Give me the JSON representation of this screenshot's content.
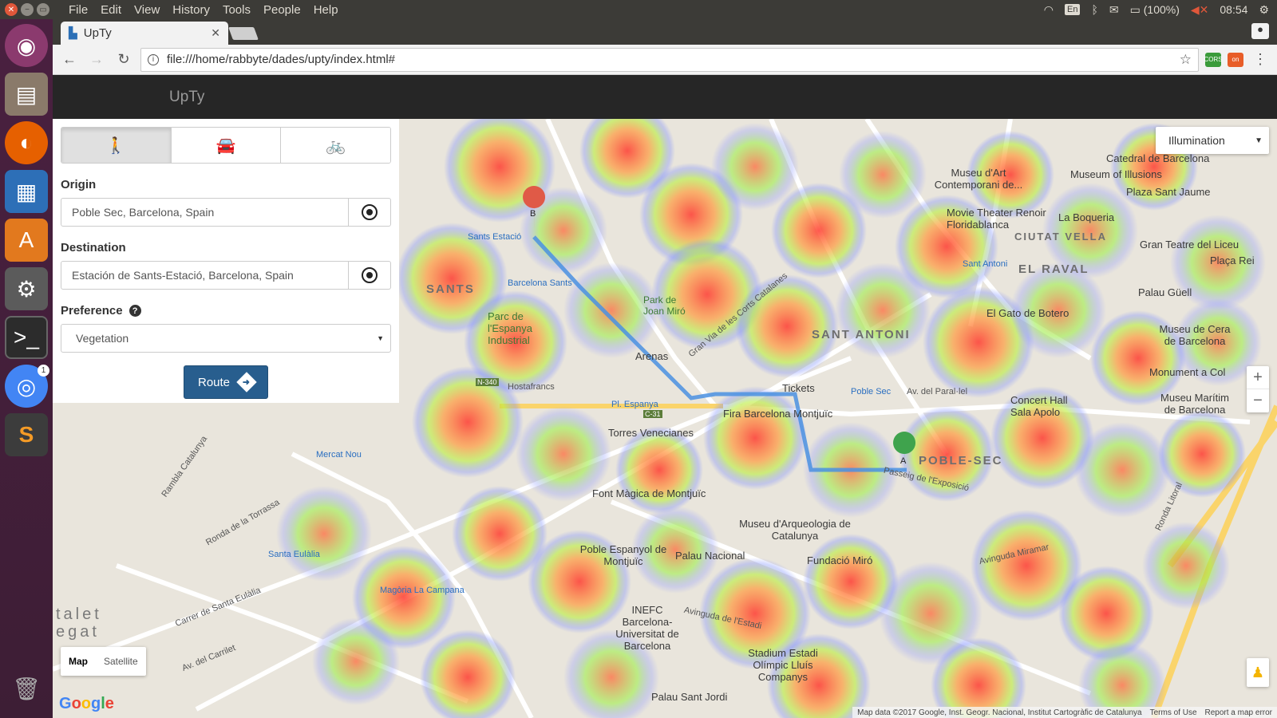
{
  "os": {
    "menu": [
      "File",
      "Edit",
      "View",
      "History",
      "Tools",
      "People",
      "Help"
    ],
    "keyboard": "En",
    "battery": "(100%)",
    "clock": "08:54"
  },
  "launcher": {
    "items": [
      "ubuntu-dash",
      "files",
      "firefox",
      "libreoffice-writer",
      "software-center",
      "system-settings",
      "terminal",
      "chromium",
      "sublime-text"
    ],
    "chromium_badge": "1"
  },
  "browser": {
    "tab_title": "UpTy",
    "url": "file:///home/rabbyte/dades/upty/index.html#",
    "ext_cors": "CORS",
    "ext_on": "on"
  },
  "app": {
    "title": "UpTy"
  },
  "panel": {
    "modes": [
      "walk",
      "car",
      "bike"
    ],
    "origin_label": "Origin",
    "origin_value": "Poble Sec, Barcelona, Spain",
    "destination_label": "Destination",
    "destination_value": "Estación de Sants-Estació, Barcelona, Spain",
    "preference_label": "Preference",
    "preference_value": "Vegetation",
    "route_label": "Route"
  },
  "map": {
    "heatmap_layer": "Illumination",
    "zoom_in": "+",
    "zoom_out": "−",
    "maptype_map": "Map",
    "maptype_satellite": "Satellite",
    "attribution": "Map data ©2017 Google, Inst. Geogr. Nacional, Institut Cartogràfic de Catalunya",
    "terms": "Terms of Use",
    "report": "Report a map error",
    "marker_a": "A",
    "marker_b": "B",
    "labels": {
      "sants": "SANTS",
      "sant_antoni": "SANT ANTONI",
      "el_raval": "EL RAVAL",
      "poble_sec": "POBLE-SEC",
      "ciutat_vella": "CIUTAT VELLA",
      "santsestacio": "Sants Estació",
      "barcelona_sants": "Barcelona Sants",
      "parc_espanya": "Parc de l'Espanya Industrial",
      "park_joan_miro": "Park de Joan Miró",
      "arenas": "Arenas",
      "tickets": "Tickets",
      "fira": "Fira Barcelona Montjuïc",
      "torres": "Torres Venecianes",
      "pl_espanya": "Pl. Espanya",
      "hostafrancs": "Hostafrancs",
      "mercat_nou": "Mercat Nou",
      "font_magica": "Font Màgica de Montjuïc",
      "museu_arqueologia": "Museu d'Arqueologia de Catalunya",
      "poble_espanyol": "Poble Espanyol de Montjuïc",
      "palau_nacional": "Palau Nacional",
      "fundacio_miro": "Fundació Miró",
      "inefc": "INEFC Barcelona-Universitat de Barcelona",
      "stadium": "Stadium Estadi Olímpic Lluís Companys",
      "palau_sant_jordi": "Palau Sant Jordi",
      "santa_eulalia": "Santa Eulàlia",
      "magoria": "Magòria La Campana",
      "museu_art": "Museu d'Art Contemporani de...",
      "catedral": "Catedral de Barcelona",
      "museu_illusions": "Museum of Illusions",
      "plaza_sant_jaume": "Plaza Sant Jaume",
      "movie_theater": "Movie Theater Renoir Floridablanca",
      "la_boqueria": "La Boqueria",
      "gran_teatre": "Gran Teatre del Liceu",
      "placa_rei": "Plaça Rei",
      "palau_guell": "Palau Güell",
      "gato_botero": "El Gato de Botero",
      "museu_cera": "Museu de Cera de Barcelona",
      "monument_colom": "Monument a Col",
      "concert_hall": "Concert Hall Sala Apolo",
      "museu_maritim": "Museu Marítim de Barcelona",
      "avinguda_miramar": "Avinguda Miramar",
      "ronda_litoral": "Ronda Litoral",
      "av_parallel": "Av. del Paral·lel",
      "poble_sec_metro": "Poble Sec",
      "sant_antoni_metro": "Sant Antoni",
      "passeig_exposicio": "Passeig de l'Exposició",
      "talet": "talet",
      "egat": "egat",
      "carrer_santa_eulalia": "Carrer de Santa Eulàlia",
      "av_carrilet": "Av. del Carrilet",
      "avinguda_estadi": "Avinguda de l'Estadi",
      "ronda_torrassa": "Ronda de la Torrassa",
      "rambla_catalunya": "Rambla Catalunya",
      "gran_via": "Gran Via de les Corts Catalanes",
      "n340": "N-340",
      "c31": "C-31"
    }
  }
}
